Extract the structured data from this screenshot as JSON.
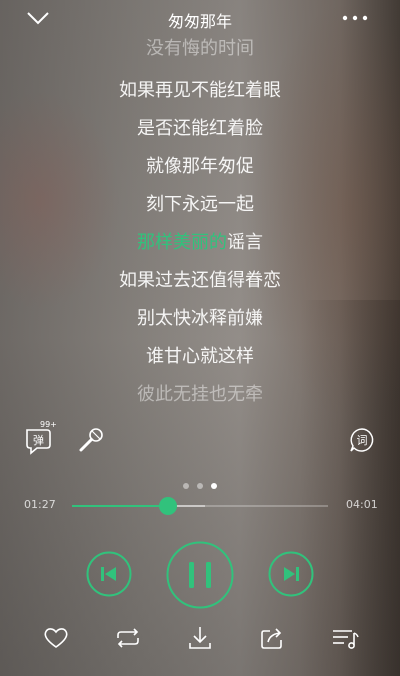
{
  "header": {
    "title": "匆匆那年",
    "back_icon": "chevron-down-icon",
    "more_icon": "more-icon"
  },
  "lyrics": {
    "lines": [
      {
        "text": "没有悔的时间",
        "state": "dim"
      },
      {
        "text": "如果再见不能红着眼",
        "state": "normal"
      },
      {
        "text": "是否还能红着脸",
        "state": "normal"
      },
      {
        "text": "就像那年匆促",
        "state": "normal"
      },
      {
        "text": "刻下永远一起",
        "state": "normal"
      },
      {
        "text": "如果过去还值得眷恋",
        "state": "normal"
      },
      {
        "text": "别太快冰释前嫌",
        "state": "normal"
      },
      {
        "text": "谁甘心就这样",
        "state": "normal"
      },
      {
        "text": "彼此无挂也无牵",
        "state": "dim"
      }
    ],
    "current": {
      "sung": "那样美丽的",
      "unsung": "谣言"
    }
  },
  "actions": {
    "danmaku_count": "99+"
  },
  "pager": {
    "count": 3,
    "active": 2
  },
  "progress": {
    "elapsed": "01:27",
    "total": "04:01",
    "played": 0.375,
    "buffered": 0.52
  },
  "colors": {
    "accent": "#31c27c"
  }
}
